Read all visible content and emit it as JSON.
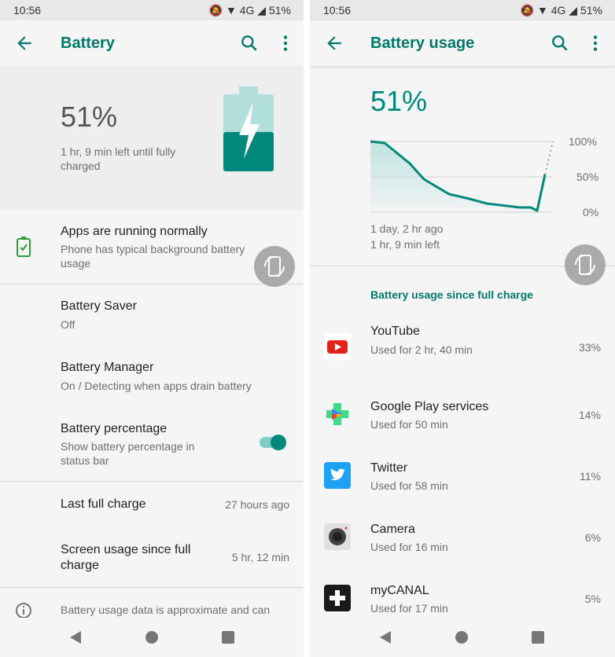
{
  "status": {
    "time": "10:56",
    "network": "4G",
    "battery": "51%"
  },
  "left": {
    "title": "Battery",
    "level": "51%",
    "time_left": "1 hr, 9 min left until fully charged",
    "apps_status": {
      "title": "Apps are running normally",
      "subtitle": "Phone has typical background battery usage"
    },
    "saver": {
      "title": "Battery Saver",
      "subtitle": "Off"
    },
    "manager": {
      "title": "Battery Manager",
      "subtitle": "On / Detecting when apps drain battery"
    },
    "percentage": {
      "title": "Battery percentage",
      "subtitle": "Show battery percentage in status bar",
      "enabled": true
    },
    "last_charge": {
      "title": "Last full charge",
      "value": "27 hours ago"
    },
    "screen_usage": {
      "title": "Screen usage since full charge",
      "value": "5 hr, 12 min"
    },
    "footer_note": "Battery usage data is approximate and can"
  },
  "right": {
    "title": "Battery usage",
    "level": "51%",
    "graph": {
      "labels_y": [
        "100%",
        "50%",
        "0%"
      ],
      "since": "1 day, 2 hr ago",
      "left": "1 hr, 9 min left"
    },
    "section_title": "Battery usage since full charge",
    "apps": [
      {
        "name": "YouTube",
        "usage": "Used for 2 hr, 40 min",
        "percent": "33%",
        "icon": "youtube-icon"
      },
      {
        "name": "Google Play services",
        "usage": "Used for 50 min",
        "percent": "14%",
        "icon": "play-services-icon"
      },
      {
        "name": "Twitter",
        "usage": "Used for 58 min",
        "percent": "11%",
        "icon": "twitter-icon"
      },
      {
        "name": "Camera",
        "usage": "Used for 16 min",
        "percent": "6%",
        "icon": "camera-icon"
      },
      {
        "name": "myCANAL",
        "usage": "Used for 17 min",
        "percent": "5%",
        "icon": "mycanal-icon"
      }
    ]
  },
  "colors": {
    "accent": "#00897b",
    "title": "#00796b"
  }
}
